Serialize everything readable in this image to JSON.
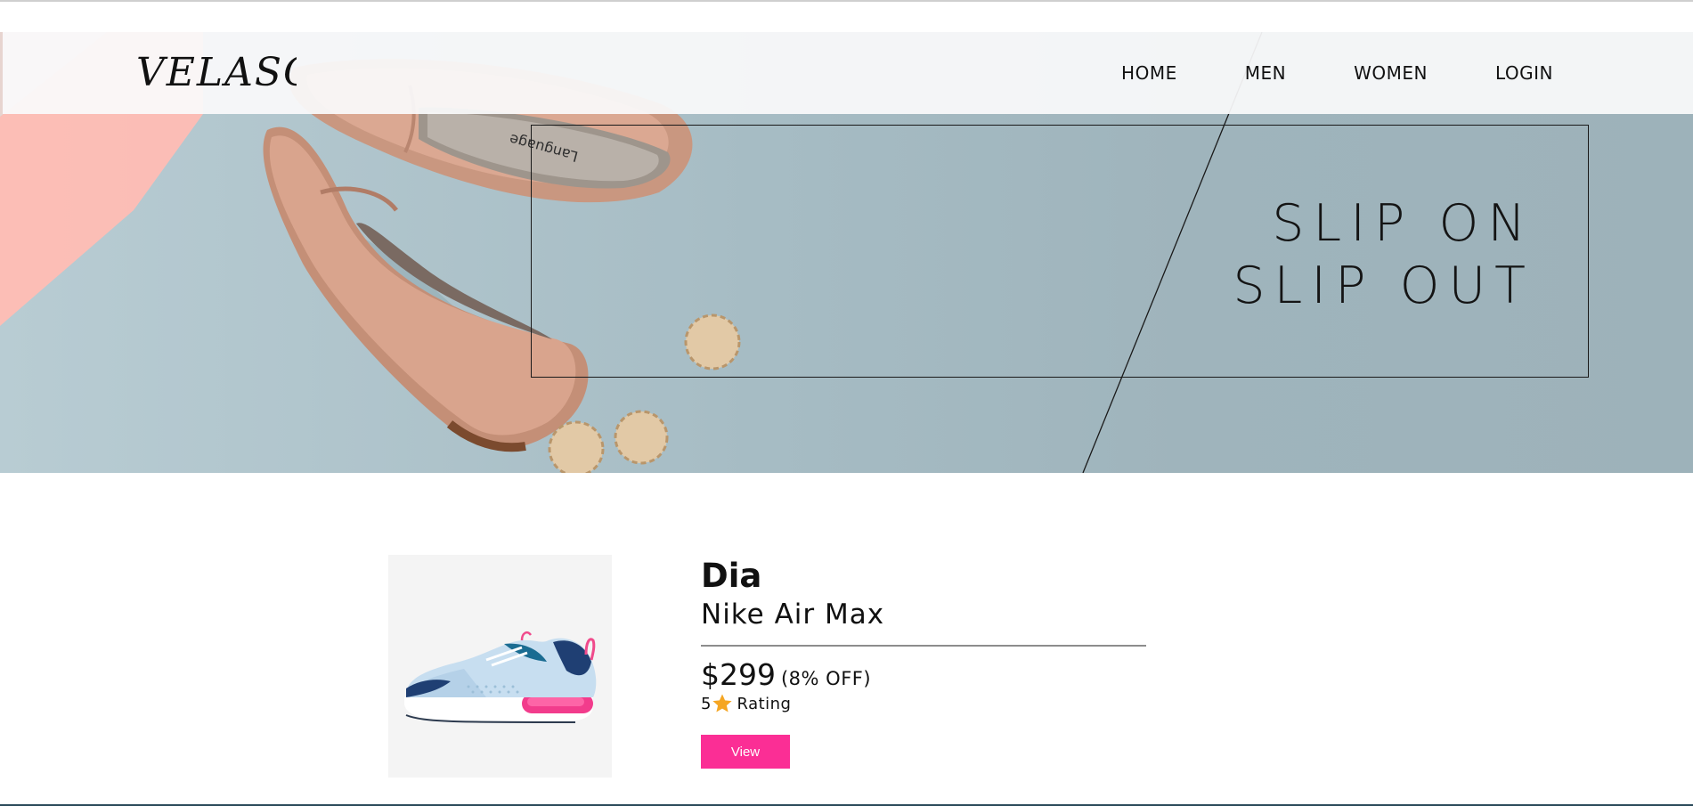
{
  "brand": {
    "logo_text": "VELASCA"
  },
  "nav": {
    "items": [
      {
        "label": "HOME"
      },
      {
        "label": "MEN"
      },
      {
        "label": "WOMEN"
      },
      {
        "label": "LOGIN"
      }
    ]
  },
  "hero": {
    "heading_line_1": "SLIP ON",
    "heading_line_2": "SLIP OUT",
    "shoe_insole_print": "Language"
  },
  "product": {
    "name": "Dia",
    "subtitle": "Nike Air Max",
    "price": "$299",
    "discount": "(8% OFF)",
    "rating_value": "5",
    "rating_icon": "star-icon",
    "rating_label": "Rating",
    "view_label": "View"
  },
  "colors": {
    "accent_pink": "#fb2e95",
    "star_orange": "#f5a623",
    "hero_blue": "#a6bcc4"
  }
}
